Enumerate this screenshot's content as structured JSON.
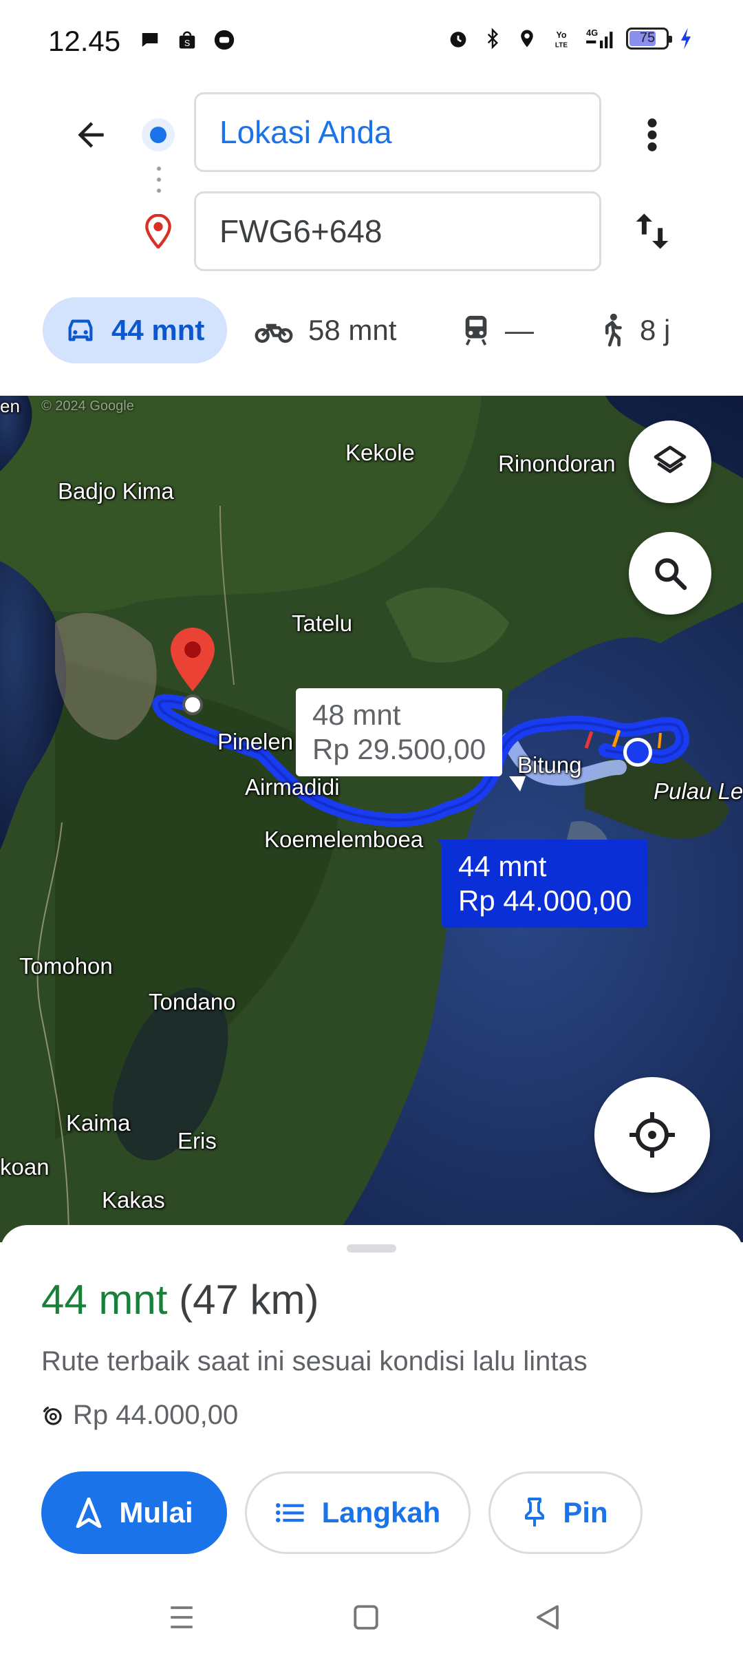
{
  "status_bar": {
    "time": "12.45",
    "left_icons": [
      "message-icon",
      "shop-icon",
      "chat-icon"
    ],
    "right_icons": [
      "alarm-icon",
      "bluetooth-icon",
      "location-icon",
      "volte-icon",
      "signal-4g-icon"
    ],
    "battery": {
      "level": "75",
      "fraction": 0.75,
      "charging": true
    }
  },
  "header": {
    "origin_value": "Lokasi Anda",
    "destination_value": "FWG6+648"
  },
  "modes": [
    {
      "name": "car",
      "label": "44 mnt",
      "active": true
    },
    {
      "name": "motorcycle",
      "label": "58 mnt",
      "active": false
    },
    {
      "name": "transit",
      "label": "—",
      "active": false
    },
    {
      "name": "walk",
      "label": "8 j",
      "active": false
    }
  ],
  "map": {
    "places": [
      "Kekole",
      "Rinondoran",
      "Badjo Kima",
      "Tatelu",
      "Pinelen",
      "Airmadidi",
      "Bitung",
      "Pulau Le",
      "Koemelemboea",
      "Tomohon",
      "Tondano",
      "Kaima",
      "Eris",
      "Kakas",
      "koan",
      "en"
    ],
    "watermark": "© 2024 Google",
    "alt_route": {
      "duration": "48 mnt",
      "price": "Rp 29.500,00"
    },
    "best_route": {
      "duration": "44 mnt",
      "price": "Rp 44.000,00"
    },
    "colors": {
      "route": "#1a3cf0",
      "route_outline": "#0a1fa8",
      "alt_route": "#a8c0ff",
      "pin": "#d93025"
    }
  },
  "sheet": {
    "duration": "44 mnt",
    "distance": "(47 km)",
    "description": "Rute terbaik saat ini sesuai kondisi lalu lintas",
    "toll_price": "Rp 44.000,00",
    "buttons": {
      "start": "Mulai",
      "steps": "Langkah",
      "pin": "Pin"
    }
  },
  "colors": {
    "accent": "#1a73e8",
    "duration_green": "#188038",
    "active_tab_bg": "#d3e3fd"
  }
}
